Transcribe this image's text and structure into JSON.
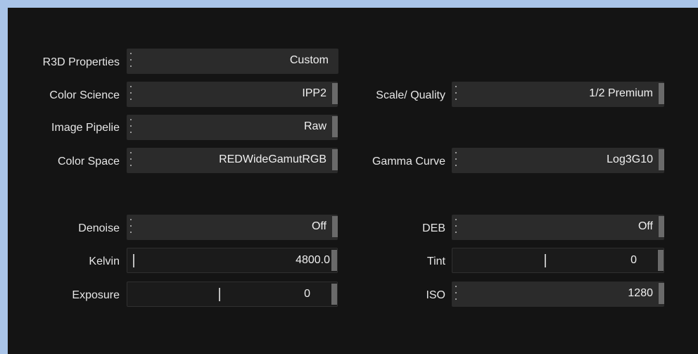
{
  "rows": {
    "r3d_properties": {
      "label": "R3D Properties",
      "value": "Custom"
    },
    "color_science": {
      "label": "Color Science",
      "value": "IPP2"
    },
    "scale_quality": {
      "label": "Scale/ Quality",
      "value": "1/2 Premium"
    },
    "image_pipeline": {
      "label": "Image Pipelie",
      "value": "Raw"
    },
    "color_space": {
      "label": "Color Space",
      "value": "REDWideGamutRGB"
    },
    "gamma_curve": {
      "label": "Gamma Curve",
      "value": "Log3G10"
    },
    "denoise": {
      "label": "Denoise",
      "value": "Off"
    },
    "deb": {
      "label": "DEB",
      "value": "Off"
    },
    "kelvin": {
      "label": "Kelvin",
      "value": "4800.0"
    },
    "tint": {
      "label": "Tint",
      "value": "0"
    },
    "exposure": {
      "label": "Exposure",
      "value": "0"
    },
    "iso": {
      "label": "ISO",
      "value": "1280"
    }
  },
  "sliders": {
    "kelvin": {
      "position": 0.0
    },
    "tint": {
      "position": 0.5
    },
    "exposure": {
      "position": 0.5
    }
  }
}
